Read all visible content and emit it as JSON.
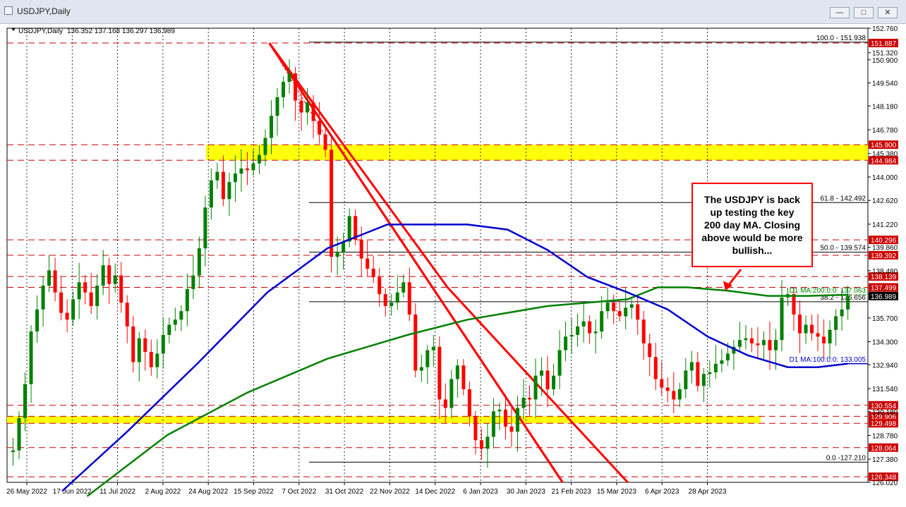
{
  "window": {
    "title": "USDJPY,Daily",
    "minimize_glyph": "—",
    "maximize_glyph": "□",
    "close_glyph": "✕"
  },
  "chart_data": {
    "type": "candlestick",
    "symbol_label": "USDJPY,Daily",
    "ohlc_label": "136.352 137.168 136.297 136.989",
    "current_price": "136.989",
    "ylim": [
      126.02,
      152.76
    ],
    "y_ticks": [
      "152.760",
      "151.320",
      "150.900",
      "149.540",
      "148.180",
      "146.780",
      "145.380",
      "144.000",
      "142.620",
      "141.220",
      "139.860",
      "138.480",
      "137.100",
      "135.700",
      "134.300",
      "132.940",
      "131.540",
      "130.180",
      "128.780",
      "127.380",
      "126.020"
    ],
    "x_labels": [
      "26 May 2022",
      "17 Jun 2022",
      "11 Jul 2022",
      "2 Aug 2022",
      "24 Aug 2022",
      "15 Sep 2022",
      "7 Oct 2022",
      "31 Oct 2022",
      "22 Nov 2022",
      "14 Dec 2022",
      "6 Jan 2023",
      "30 Jan 2023",
      "21 Feb 2023",
      "15 Mar 2023",
      "6 Apr 2023",
      "28 Apr 2023"
    ],
    "price_path": [
      [
        0,
        127.8
      ],
      [
        6,
        127.9
      ],
      [
        12,
        129.8
      ],
      [
        18,
        131.8
      ],
      [
        24,
        134.9
      ],
      [
        30,
        136.2
      ],
      [
        36,
        137.6
      ],
      [
        42,
        138.5
      ],
      [
        48,
        137.2
      ],
      [
        54,
        136.0
      ],
      [
        60,
        135.6
      ],
      [
        66,
        136.8
      ],
      [
        72,
        137.8
      ],
      [
        78,
        137.2
      ],
      [
        84,
        136.4
      ],
      [
        90,
        137.6
      ],
      [
        96,
        138.8
      ],
      [
        102,
        137.7
      ],
      [
        108,
        138.2
      ],
      [
        114,
        136.6
      ],
      [
        120,
        135.2
      ],
      [
        126,
        133.1
      ],
      [
        132,
        134.5
      ],
      [
        138,
        133.7
      ],
      [
        144,
        132.8
      ],
      [
        150,
        133.6
      ],
      [
        156,
        134.7
      ],
      [
        162,
        135.3
      ],
      [
        168,
        135.6
      ],
      [
        174,
        136.1
      ],
      [
        180,
        137.4
      ],
      [
        186,
        138.2
      ],
      [
        192,
        139.8
      ],
      [
        198,
        142.2
      ],
      [
        204,
        143.8
      ],
      [
        210,
        144.3
      ],
      [
        216,
        142.7
      ],
      [
        222,
        143.7
      ],
      [
        228,
        144.2
      ],
      [
        234,
        144.5
      ],
      [
        240,
        144.4
      ],
      [
        246,
        144.8
      ],
      [
        252,
        145.3
      ],
      [
        258,
        146.3
      ],
      [
        264,
        147.6
      ],
      [
        270,
        148.7
      ],
      [
        276,
        149.6
      ],
      [
        282,
        150.1
      ],
      [
        288,
        148.5
      ],
      [
        294,
        147.8
      ],
      [
        300,
        148.4
      ],
      [
        306,
        147.3
      ],
      [
        312,
        146.5
      ],
      [
        318,
        145.6
      ],
      [
        324,
        139.3
      ],
      [
        330,
        139.6
      ],
      [
        336,
        140.2
      ],
      [
        342,
        141.7
      ],
      [
        348,
        140.3
      ],
      [
        354,
        139.2
      ],
      [
        360,
        138.6
      ],
      [
        366,
        138.1
      ],
      [
        372,
        137.1
      ],
      [
        378,
        136.4
      ],
      [
        384,
        136.6
      ],
      [
        390,
        137.2
      ],
      [
        396,
        137.8
      ],
      [
        402,
        135.9
      ],
      [
        408,
        132.6
      ],
      [
        414,
        132.8
      ],
      [
        420,
        133.8
      ],
      [
        426,
        134.0
      ],
      [
        432,
        130.9
      ],
      [
        438,
        130.4
      ],
      [
        444,
        132.1
      ],
      [
        450,
        132.9
      ],
      [
        456,
        131.5
      ],
      [
        462,
        129.9
      ],
      [
        468,
        128.5
      ],
      [
        474,
        128.0
      ],
      [
        480,
        128.7
      ],
      [
        486,
        130.2
      ],
      [
        492,
        130.3
      ],
      [
        498,
        129.3
      ],
      [
        504,
        129.0
      ],
      [
        510,
        130.4
      ],
      [
        516,
        131.0
      ],
      [
        522,
        130.9
      ],
      [
        528,
        132.3
      ],
      [
        534,
        132.6
      ],
      [
        540,
        131.5
      ],
      [
        546,
        132.3
      ],
      [
        552,
        133.8
      ],
      [
        558,
        134.6
      ],
      [
        564,
        134.7
      ],
      [
        570,
        135.2
      ],
      [
        576,
        135.5
      ],
      [
        582,
        134.8
      ],
      [
        588,
        134.9
      ],
      [
        594,
        136.1
      ],
      [
        600,
        136.6
      ],
      [
        606,
        136.1
      ],
      [
        612,
        135.8
      ],
      [
        618,
        136.3
      ],
      [
        624,
        136.5
      ],
      [
        630,
        135.6
      ],
      [
        636,
        134.2
      ],
      [
        642,
        133.4
      ],
      [
        648,
        132.1
      ],
      [
        654,
        131.6
      ],
      [
        660,
        131.4
      ],
      [
        666,
        130.9
      ],
      [
        672,
        131.5
      ],
      [
        678,
        132.6
      ],
      [
        684,
        133.1
      ],
      [
        690,
        131.7
      ],
      [
        696,
        132.4
      ],
      [
        702,
        132.5
      ],
      [
        708,
        133.0
      ],
      [
        714,
        133.2
      ],
      [
        720,
        133.6
      ],
      [
        726,
        134.0
      ],
      [
        732,
        134.4
      ],
      [
        738,
        134.5
      ],
      [
        744,
        134.2
      ],
      [
        750,
        134.1
      ],
      [
        756,
        134.4
      ],
      [
        762,
        133.8
      ],
      [
        768,
        134.4
      ],
      [
        774,
        136.9
      ],
      [
        780,
        137.1
      ],
      [
        786,
        135.9
      ],
      [
        792,
        134.8
      ],
      [
        798,
        135.3
      ],
      [
        804,
        134.8
      ],
      [
        810,
        134.6
      ],
      [
        816,
        134.2
      ],
      [
        822,
        135.0
      ],
      [
        828,
        135.8
      ],
      [
        834,
        136.2
      ],
      [
        840,
        136.99
      ]
    ],
    "ma200_path": [
      [
        80,
        125.2
      ],
      [
        160,
        128.8
      ],
      [
        240,
        131.3
      ],
      [
        320,
        133.3
      ],
      [
        400,
        134.7
      ],
      [
        460,
        135.6
      ],
      [
        500,
        136.0
      ],
      [
        540,
        136.4
      ],
      [
        580,
        136.6
      ],
      [
        620,
        136.8
      ],
      [
        650,
        137.5
      ],
      [
        680,
        137.5
      ],
      [
        720,
        137.3
      ],
      [
        760,
        137.0
      ],
      [
        800,
        137.0
      ],
      [
        840,
        137.063
      ]
    ],
    "ma100_path": [
      [
        55,
        125.5
      ],
      [
        120,
        129.0
      ],
      [
        190,
        133.0
      ],
      [
        260,
        137.2
      ],
      [
        320,
        139.8
      ],
      [
        380,
        141.2
      ],
      [
        420,
        141.2
      ],
      [
        460,
        141.2
      ],
      [
        500,
        140.9
      ],
      [
        540,
        139.7
      ],
      [
        580,
        138.1
      ],
      [
        620,
        137.2
      ],
      [
        660,
        136.2
      ],
      [
        700,
        134.6
      ],
      [
        740,
        133.5
      ],
      [
        780,
        132.8
      ],
      [
        810,
        132.8
      ],
      [
        840,
        133.005
      ]
    ],
    "horizontal_levels": [
      {
        "price": 151.887,
        "label": "151.887"
      },
      {
        "price": 145.9,
        "label": "145.900"
      },
      {
        "price": 144.984,
        "label": "144.984"
      },
      {
        "price": 140.296,
        "label": "140.296"
      },
      {
        "price": 139.392,
        "label": "139.392"
      },
      {
        "price": 138.139,
        "label": "138.139"
      },
      {
        "price": 137.499,
        "label": "137.499"
      },
      {
        "price": 130.554,
        "label": "130.554"
      },
      {
        "price": 129.906,
        "label": "129.906"
      },
      {
        "price": 129.498,
        "label": "129.498"
      },
      {
        "price": 128.064,
        "label": "128.064"
      },
      {
        "price": 126.348,
        "label": "126.348"
      }
    ],
    "fib_levels": [
      {
        "price": 151.938,
        "label": "100.0 - 151.938"
      },
      {
        "price": 142.492,
        "label": "61.8 - 142.492"
      },
      {
        "price": 139.574,
        "label": "50.0 - 139.574"
      },
      {
        "price": 136.656,
        "label": "38.2 - 136.656"
      },
      {
        "price": 127.21,
        "label": "0.0 -127.210"
      }
    ],
    "ma_labels": {
      "ma200": {
        "label": "D1 MA:200:0:0: 137.063",
        "price": 137.063
      },
      "ma100": {
        "label": "D1 MA:100:0:0: 133.005",
        "price": 133.005
      }
    },
    "support_zones": [
      {
        "from": 144.984,
        "to": 145.9
      },
      {
        "from": 129.498,
        "to": 129.906
      }
    ],
    "channel_lines": [
      {
        "x1": 262,
        "y1": 151.887,
        "x2": 555,
        "y2": 126.02
      },
      {
        "x1": 262,
        "y1": 151.887,
        "x2": 440,
        "y2": 137.5
      },
      {
        "x1": 440,
        "y1": 137.5,
        "x2": 620,
        "y2": 126.02
      }
    ],
    "annotation": {
      "text": [
        "The USDJPY is back",
        "up testing the key",
        "200 day MA.  Closing",
        "above would be more",
        "bullish..."
      ]
    },
    "colors": {
      "candle_up": "#008000",
      "candle_down": "#ff0000",
      "ma200": "#008000",
      "ma100": "#0000cc",
      "level_line": "#cc0000",
      "zone": "#ffff00",
      "annotation_border": "#ff0000"
    }
  }
}
